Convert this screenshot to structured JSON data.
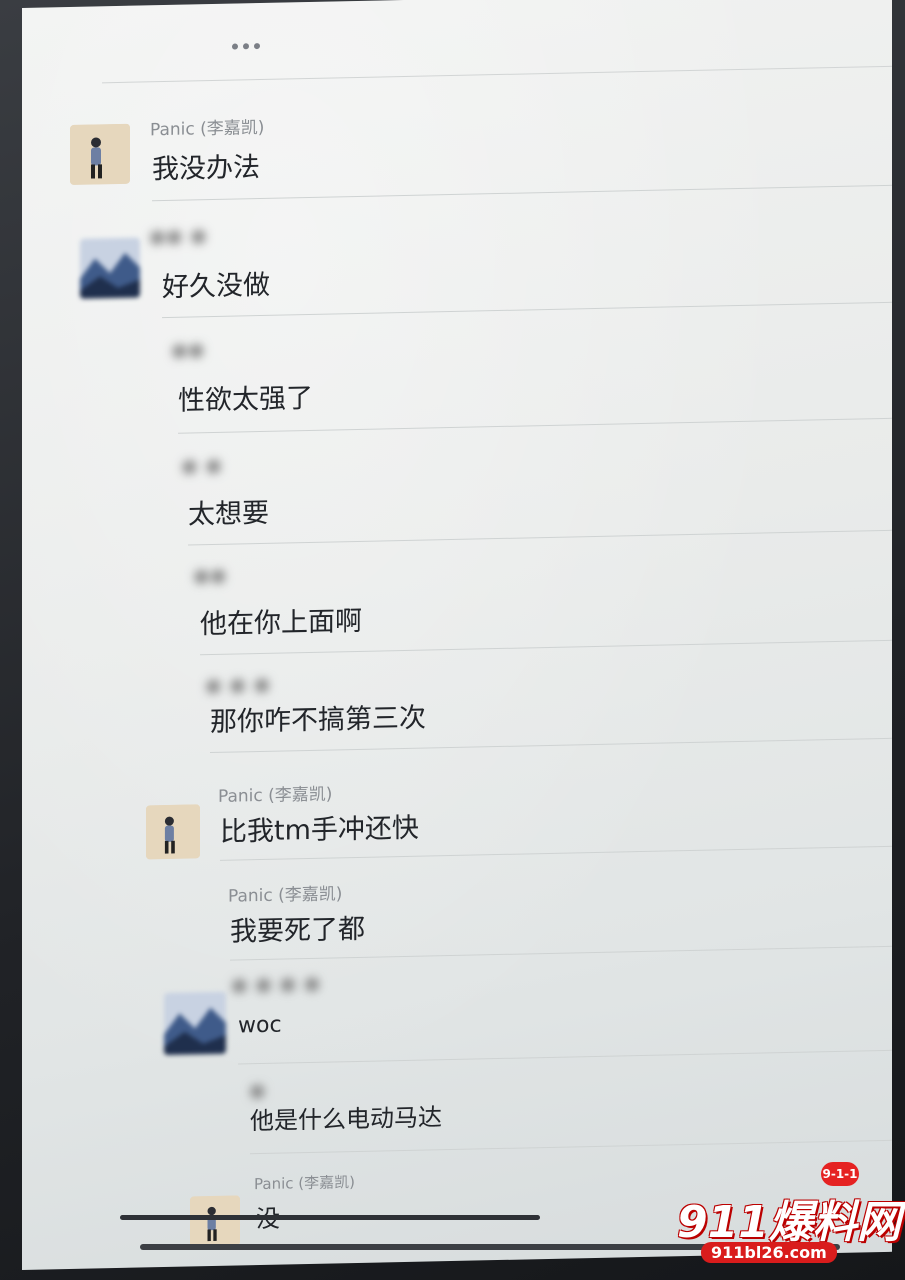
{
  "chat": {
    "messages": [
      {
        "sender": "Panic (李嘉凯)",
        "text": "我没办法",
        "avatar": "person-avatar"
      },
      {
        "sender": "",
        "text": "好久没做",
        "avatar": "blurred-avatar"
      },
      {
        "sender": "",
        "text": "性欲太强了",
        "avatar": null
      },
      {
        "sender": "",
        "text": "太想要",
        "avatar": null
      },
      {
        "sender": "",
        "text": "他在你上面啊",
        "avatar": null
      },
      {
        "sender": "",
        "text": "那你咋不搞第三次",
        "avatar": null
      },
      {
        "sender": "Panic (李嘉凯)",
        "text": "比我tm手冲还快",
        "avatar": "person-avatar"
      },
      {
        "sender": "Panic (李嘉凯)",
        "text": "我要死了都",
        "avatar": null
      },
      {
        "sender": "",
        "text": "woc",
        "avatar": "blurred-avatar"
      },
      {
        "sender": "",
        "text": "他是什么电动马达",
        "avatar": null
      },
      {
        "sender": "Panic (李嘉凯)",
        "text": "没",
        "avatar": "person-avatar"
      }
    ]
  },
  "watermark": {
    "badge": "9-1-1",
    "title": "911爆料网",
    "url": "911bl26.com"
  },
  "colors": {
    "screen_bg": "#eceeed",
    "text": "#22252a",
    "sender": "#8a8e93",
    "watermark_red": "#d91c1c"
  }
}
